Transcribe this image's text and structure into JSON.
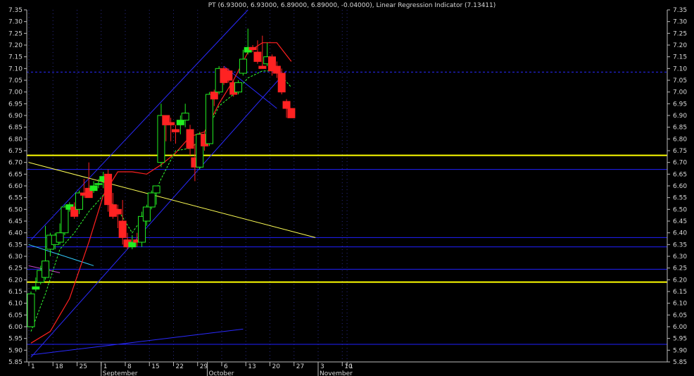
{
  "chart_data": {
    "type": "candlestick",
    "title": "PT (6.93000, 6.93000, 6.89000, 6.89000, -0.04000), Linear Regression Indicator (7.13411)",
    "ylim": [
      5.85,
      7.35
    ],
    "y_ticks": [
      5.85,
      5.9,
      5.95,
      6.0,
      6.05,
      6.1,
      6.15,
      6.2,
      6.25,
      6.3,
      6.35,
      6.4,
      6.45,
      6.5,
      6.55,
      6.6,
      6.65,
      6.7,
      6.75,
      6.8,
      6.85,
      6.9,
      6.95,
      7.0,
      7.05,
      7.1,
      7.15,
      7.2,
      7.25,
      7.3,
      7.35
    ],
    "x_day_ticks": [
      {
        "label": "1",
        "i": 0
      },
      {
        "label": "18",
        "i": 5
      },
      {
        "label": "25",
        "i": 10
      },
      {
        "label": "1",
        "i": 15
      },
      {
        "label": "8",
        "i": 20
      },
      {
        "label": "15",
        "i": 25
      },
      {
        "label": "22",
        "i": 30
      },
      {
        "label": "29",
        "i": 35
      },
      {
        "label": "6",
        "i": 40
      },
      {
        "label": "13",
        "i": 45
      },
      {
        "label": "20",
        "i": 50
      },
      {
        "label": "27",
        "i": 55
      },
      {
        "label": "3",
        "i": 60
      },
      {
        "label": "10",
        "i": 65
      },
      {
        "label": "1",
        "i": 66
      }
    ],
    "x_month_labels": [
      {
        "label": "September",
        "i": 15
      },
      {
        "label": "October",
        "i": 37
      },
      {
        "label": "November",
        "i": 60
      }
    ],
    "candles": [
      {
        "i": 0,
        "o": 6.0,
        "h": 6.15,
        "l": 6.0,
        "c": 6.14
      },
      {
        "i": 1,
        "o": 6.16,
        "h": 6.21,
        "l": 6.15,
        "c": 6.17
      },
      {
        "i": 2,
        "o": 6.19,
        "h": 6.26,
        "l": 6.18,
        "c": 6.24
      },
      {
        "i": 3,
        "o": 6.21,
        "h": 6.43,
        "l": 6.2,
        "c": 6.28
      },
      {
        "i": 4,
        "o": 6.33,
        "h": 6.4,
        "l": 6.3,
        "c": 6.39
      },
      {
        "i": 5,
        "o": 6.35,
        "h": 6.4,
        "l": 6.33,
        "c": 6.39
      },
      {
        "i": 6,
        "o": 6.36,
        "h": 6.44,
        "l": 6.35,
        "c": 6.4
      },
      {
        "i": 7,
        "o": 6.4,
        "h": 6.52,
        "l": 6.39,
        "c": 6.51
      },
      {
        "i": 8,
        "o": 6.5,
        "h": 6.53,
        "l": 6.49,
        "c": 6.52
      },
      {
        "i": 9,
        "o": 6.51,
        "h": 6.53,
        "l": 6.46,
        "c": 6.47
      },
      {
        "i": 10,
        "o": 6.5,
        "h": 6.58,
        "l": 6.48,
        "c": 6.57
      },
      {
        "i": 11,
        "o": 6.57,
        "h": 6.63,
        "l": 6.55,
        "c": 6.56
      },
      {
        "i": 12,
        "o": 6.59,
        "h": 6.7,
        "l": 6.55,
        "c": 6.55
      },
      {
        "i": 13,
        "o": 6.58,
        "h": 6.62,
        "l": 6.57,
        "c": 6.6
      },
      {
        "i": 14,
        "o": 6.61,
        "h": 6.63,
        "l": 6.59,
        "c": 6.61
      },
      {
        "i": 15,
        "o": 6.62,
        "h": 6.66,
        "l": 6.59,
        "c": 6.64
      },
      {
        "i": 16,
        "o": 6.65,
        "h": 6.67,
        "l": 6.49,
        "c": 6.52
      },
      {
        "i": 17,
        "o": 6.52,
        "h": 6.57,
        "l": 6.46,
        "c": 6.47
      },
      {
        "i": 18,
        "o": 6.5,
        "h": 6.52,
        "l": 6.42,
        "c": 6.48
      },
      {
        "i": 19,
        "o": 6.45,
        "h": 6.54,
        "l": 6.35,
        "c": 6.38
      },
      {
        "i": 20,
        "o": 6.37,
        "h": 6.4,
        "l": 6.33,
        "c": 6.34
      },
      {
        "i": 21,
        "o": 6.34,
        "h": 6.39,
        "l": 6.33,
        "c": 6.36
      },
      {
        "i": 22,
        "o": 6.37,
        "h": 6.4,
        "l": 6.34,
        "c": 6.36
      },
      {
        "i": 23,
        "o": 6.36,
        "h": 6.49,
        "l": 6.34,
        "c": 6.47
      },
      {
        "i": 24,
        "o": 6.45,
        "h": 6.52,
        "l": 6.43,
        "c": 6.51
      },
      {
        "i": 25,
        "o": 6.51,
        "h": 6.58,
        "l": 6.5,
        "c": 6.57
      },
      {
        "i": 26,
        "o": 6.57,
        "h": 6.6,
        "l": 6.52,
        "c": 6.6
      },
      {
        "i": 27,
        "o": 6.7,
        "h": 6.95,
        "l": 6.68,
        "c": 6.9
      },
      {
        "i": 28,
        "o": 6.9,
        "h": 6.9,
        "l": 6.79,
        "c": 6.86
      },
      {
        "i": 29,
        "o": 6.87,
        "h": 6.89,
        "l": 6.79,
        "c": 6.86
      },
      {
        "i": 30,
        "o": 6.84,
        "h": 6.86,
        "l": 6.78,
        "c": 6.83
      },
      {
        "i": 31,
        "o": 6.86,
        "h": 6.9,
        "l": 6.82,
        "c": 6.88
      },
      {
        "i": 32,
        "o": 6.88,
        "h": 6.95,
        "l": 6.85,
        "c": 6.91
      },
      {
        "i": 33,
        "o": 6.84,
        "h": 6.86,
        "l": 6.73,
        "c": 6.76
      },
      {
        "i": 34,
        "o": 6.72,
        "h": 6.78,
        "l": 6.62,
        "c": 6.68
      },
      {
        "i": 35,
        "o": 6.68,
        "h": 6.83,
        "l": 6.67,
        "c": 6.82
      },
      {
        "i": 36,
        "o": 6.82,
        "h": 6.83,
        "l": 6.75,
        "c": 6.77
      },
      {
        "i": 37,
        "o": 6.78,
        "h": 7.0,
        "l": 6.77,
        "c": 6.99
      },
      {
        "i": 38,
        "o": 7.0,
        "h": 7.01,
        "l": 6.94,
        "c": 6.97
      },
      {
        "i": 39,
        "o": 7.0,
        "h": 7.11,
        "l": 6.99,
        "c": 7.1
      },
      {
        "i": 40,
        "o": 7.1,
        "h": 7.11,
        "l": 7.03,
        "c": 7.04
      },
      {
        "i": 41,
        "o": 7.09,
        "h": 7.1,
        "l": 7.04,
        "c": 7.05
      },
      {
        "i": 42,
        "o": 7.04,
        "h": 7.05,
        "l": 6.98,
        "c": 6.99
      },
      {
        "i": 43,
        "o": 7.0,
        "h": 7.05,
        "l": 6.99,
        "c": 7.04
      },
      {
        "i": 44,
        "o": 7.08,
        "h": 7.18,
        "l": 7.07,
        "c": 7.14
      },
      {
        "i": 45,
        "o": 7.17,
        "h": 7.27,
        "l": 7.16,
        "c": 7.19
      },
      {
        "i": 46,
        "o": 7.19,
        "h": 7.2,
        "l": 7.17,
        "c": 7.18
      },
      {
        "i": 47,
        "o": 7.17,
        "h": 7.22,
        "l": 7.12,
        "c": 7.13
      },
      {
        "i": 48,
        "o": 7.11,
        "h": 7.24,
        "l": 7.1,
        "c": 7.1
      },
      {
        "i": 49,
        "o": 7.12,
        "h": 7.21,
        "l": 7.11,
        "c": 7.15
      },
      {
        "i": 50,
        "o": 7.15,
        "h": 7.16,
        "l": 7.07,
        "c": 7.09
      },
      {
        "i": 51,
        "o": 7.11,
        "h": 7.13,
        "l": 7.06,
        "c": 7.08
      },
      {
        "i": 52,
        "o": 7.08,
        "h": 7.1,
        "l": 6.99,
        "c": 7.0
      },
      {
        "i": 53,
        "o": 6.96,
        "h": 6.97,
        "l": 6.89,
        "c": 6.93
      },
      {
        "i": 54,
        "o": 6.93,
        "h": 6.93,
        "l": 6.89,
        "c": 6.89
      }
    ],
    "red_line": [
      [
        0,
        5.93
      ],
      [
        4,
        5.98
      ],
      [
        8,
        6.12
      ],
      [
        12,
        6.36
      ],
      [
        15,
        6.56
      ],
      [
        18,
        6.66
      ],
      [
        21,
        6.66
      ],
      [
        24,
        6.65
      ],
      [
        27,
        6.69
      ],
      [
        30,
        6.74
      ],
      [
        33,
        6.81
      ],
      [
        36,
        6.83
      ],
      [
        39,
        6.95
      ],
      [
        42,
        7.05
      ],
      [
        45,
        7.17
      ],
      [
        48,
        7.21
      ],
      [
        51,
        7.21
      ],
      [
        54,
        7.13
      ]
    ],
    "green_dashed_line": [
      [
        0,
        5.98
      ],
      [
        3,
        6.14
      ],
      [
        6,
        6.33
      ],
      [
        9,
        6.4
      ],
      [
        12,
        6.49
      ],
      [
        15,
        6.56
      ],
      [
        18,
        6.5
      ],
      [
        21,
        6.4
      ],
      [
        24,
        6.49
      ],
      [
        27,
        6.63
      ],
      [
        30,
        6.75
      ],
      [
        33,
        6.76
      ],
      [
        36,
        6.81
      ],
      [
        39,
        6.94
      ],
      [
        42,
        6.99
      ],
      [
        45,
        7.06
      ],
      [
        48,
        7.09
      ],
      [
        51,
        7.09
      ],
      [
        54,
        7.02
      ]
    ],
    "h_lines": [
      {
        "y": 7.085,
        "color": "#2a2aff",
        "dashed": true
      },
      {
        "y": 6.73,
        "color": "#ffff00",
        "width": 2
      },
      {
        "y": 6.67,
        "color": "#2020ff"
      },
      {
        "y": 6.38,
        "color": "#2020ff"
      },
      {
        "y": 6.34,
        "color": "#2020ff"
      },
      {
        "y": 6.245,
        "color": "#2020ff"
      },
      {
        "y": 6.19,
        "color": "#ffff00",
        "width": 2
      },
      {
        "y": 5.925,
        "color": "#2020ff"
      }
    ],
    "trend_lines": [
      {
        "x1": 0,
        "y1": 6.37,
        "x2": 45,
        "y2": 7.35,
        "color": "#2a2aff"
      },
      {
        "x1": 0,
        "y1": 5.87,
        "x2": 53,
        "y2": 7.09,
        "color": "#2a2aff"
      },
      {
        "x1": 0,
        "y1": 5.88,
        "x2": 44,
        "y2": 5.99,
        "color": "#2a2aff"
      },
      {
        "x1": -0.5,
        "y1": 6.7,
        "x2": 59,
        "y2": 6.38,
        "color": "#ffff55"
      },
      {
        "x1": -0.5,
        "y1": 6.35,
        "x2": 13,
        "y2": 6.26,
        "color": "#33ccff"
      },
      {
        "x1": -0.5,
        "y1": 6.26,
        "x2": 6,
        "y2": 6.23,
        "color": "#cc44cc"
      },
      {
        "x1": 40,
        "y1": 7.11,
        "x2": 51,
        "y2": 6.93,
        "color": "#2a2aff"
      }
    ]
  }
}
